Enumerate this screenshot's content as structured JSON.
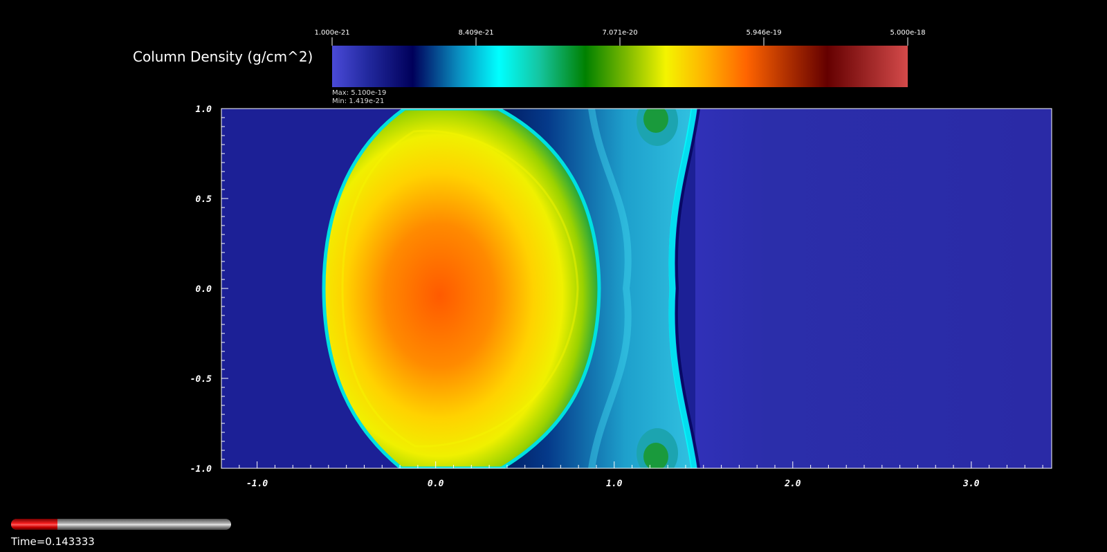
{
  "chart_data": {
    "type": "heatmap",
    "colorbar": {
      "title": "Column Density (g/cm^2)",
      "tick_labels": [
        "1.000e-21",
        "8.409e-21",
        "7.071e-20",
        "5.946e-19",
        "5.000e-18"
      ],
      "range": [
        1e-21,
        5e-18
      ],
      "scale": "log",
      "max_label": "Max:  5.100e-19",
      "min_label": "Min:  1.419e-21"
    },
    "xlim": [
      -1.2,
      3.45
    ],
    "ylim": [
      -1.0,
      1.0
    ],
    "x_ticks": [
      -1.0,
      0.0,
      1.0,
      2.0,
      3.0
    ],
    "x_tick_labels": [
      "-1.0",
      "0.0",
      "1.0",
      "2.0",
      "3.0"
    ],
    "y_ticks": [
      -1.0,
      -0.5,
      0.0,
      0.5,
      1.0
    ],
    "y_tick_labels": [
      "-1.0",
      "-0.5",
      "0.0",
      "0.5",
      "1.0"
    ],
    "features": {
      "cloud_center": [
        0.03,
        0.0
      ],
      "cloud_peak_density": 5.1e-19,
      "ambient_density": 1.419e-21,
      "shock_front_x": 1.45
    }
  },
  "animation": {
    "progress": 0.21,
    "time_label": "Time=0.143333"
  }
}
